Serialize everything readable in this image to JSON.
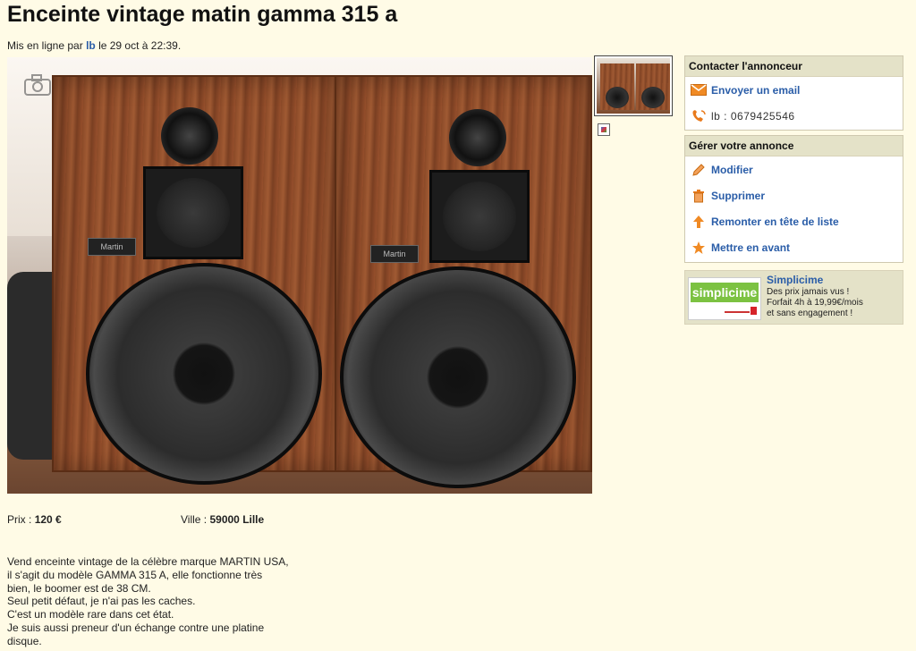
{
  "listing": {
    "title": "Enceinte vintage matin gamma 315 a",
    "posted_prefix": "Mis en ligne par",
    "author": "lb",
    "posted_suffix": "le 29 oct à 22:39."
  },
  "photo": {
    "badge_left": "Martin",
    "badge_right": "Martin"
  },
  "contact": {
    "header": "Contacter l'annonceur",
    "email_label": "Envoyer un email",
    "phone": "lb : 0679425546"
  },
  "manage": {
    "header": "Gérer votre annonce",
    "items": [
      {
        "label": "Modifier",
        "icon": "pencil-icon"
      },
      {
        "label": "Supprimer",
        "icon": "trash-icon"
      },
      {
        "label": "Remonter en tête de liste",
        "icon": "arrow-up-icon"
      },
      {
        "label": "Mettre en avant",
        "icon": "star-icon"
      }
    ]
  },
  "ad": {
    "logo_text": "simplicime",
    "name": "Simplicime",
    "line1": "Des prix jamais vus !",
    "line2": "Forfait 4h à 19,99€/mois",
    "line3": "et sans engagement !"
  },
  "details": {
    "price_label": "Prix :",
    "price_value": "120 €",
    "city_label": "Ville :",
    "city_value": "59000 Lille"
  },
  "description": [
    "Vend enceinte vintage de la célèbre marque MARTIN USA,",
    "il s'agit du modèle GAMMA 315 A, elle fonctionne très",
    "bien, le boomer est de 38 CM.",
    "Seul petit défaut, je n'ai pas les caches.",
    "C'est un modèle rare dans cet état.",
    "Je suis aussi preneur d'un échange contre une platine",
    "disque."
  ],
  "colors": {
    "background": "#fffbe6",
    "link": "#2a5da8",
    "panel_header": "#e4e2c8",
    "icon_accent": "#e87a1c"
  }
}
